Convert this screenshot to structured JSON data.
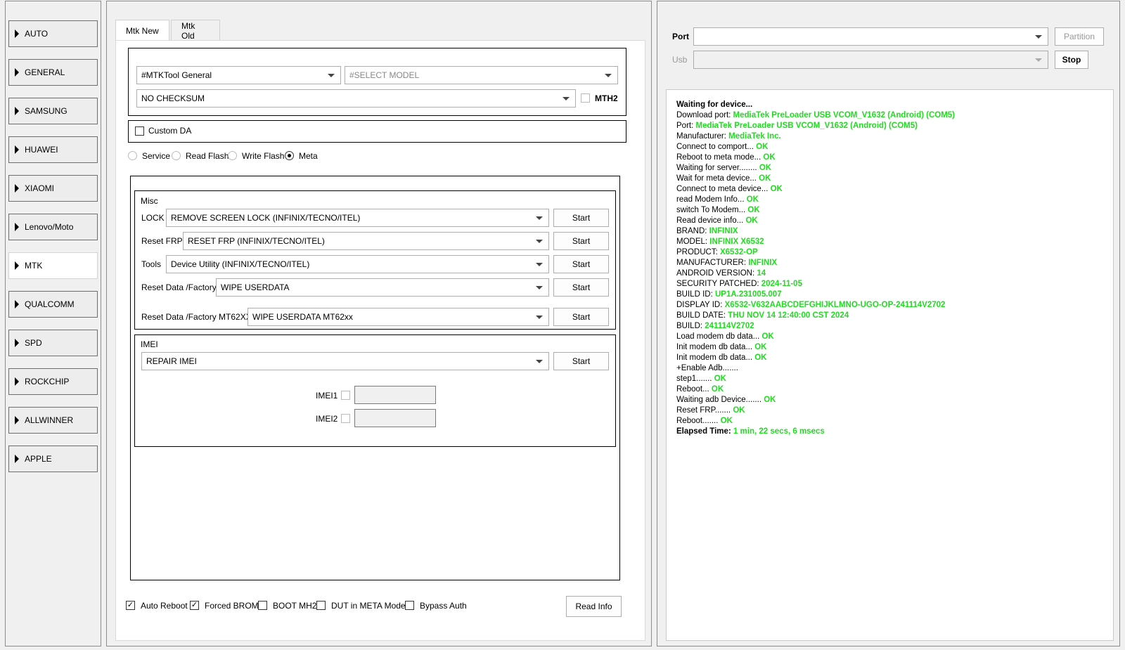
{
  "sidebar": {
    "items": [
      {
        "label": "AUTO"
      },
      {
        "label": "GENERAL"
      },
      {
        "label": "SAMSUNG"
      },
      {
        "label": "HUAWEI"
      },
      {
        "label": "XIAOMI"
      },
      {
        "label": "Lenovo/Moto"
      },
      {
        "label": "MTK"
      },
      {
        "label": "QUALCOMM"
      },
      {
        "label": "SPD"
      },
      {
        "label": "ROCKCHIP"
      },
      {
        "label": "ALLWINNER"
      },
      {
        "label": "APPLE"
      }
    ],
    "active": "MTK"
  },
  "tabs": [
    {
      "label": "Mtk New"
    },
    {
      "label": "Mtk Old"
    }
  ],
  "config": {
    "tool_select": "#MTKTool General",
    "model_select": "#SELECT MODEL",
    "checksum_select": "NO CHECKSUM",
    "mth2_label": "MTH2",
    "custom_da_label": "Custom DA"
  },
  "modes": [
    {
      "label": "Service",
      "selected": false
    },
    {
      "label": "Read Flash",
      "selected": false
    },
    {
      "label": "Write Flash",
      "selected": false
    },
    {
      "label": "Meta",
      "selected": true
    }
  ],
  "misc": {
    "title": "Misc",
    "rows": [
      {
        "label": "LOCK",
        "value": "REMOVE SCREEN LOCK (INFINIX/TECNO/ITEL)",
        "button": "Start"
      },
      {
        "label": "Reset FRP",
        "value": "RESET FRP (INFINIX/TECNO/ITEL)",
        "button": "Start"
      },
      {
        "label": "Tools",
        "value": "Device Utility (INFINIX/TECNO/ITEL)",
        "button": "Start"
      },
      {
        "label": "Reset Data /Factory",
        "value": "WIPE USERDATA",
        "button": "Start"
      },
      {
        "label": "Reset Data /Factory MT62XX",
        "value": "WIPE USERDATA MT62xx",
        "button": "Start"
      }
    ]
  },
  "imei": {
    "title": "IMEI",
    "select": "REPAIR IMEI",
    "button": "Start",
    "imei1_label": "IMEI1",
    "imei2_label": "IMEI2"
  },
  "options": [
    {
      "label": "Auto Reboot",
      "checked": true
    },
    {
      "label": "Forced BROM",
      "checked": true
    },
    {
      "label": "BOOT MH2",
      "checked": false
    },
    {
      "label": "DUT in META Mode",
      "checked": false
    },
    {
      "label": "Bypass Auth",
      "checked": false
    }
  ],
  "read_info_button": "Read Info",
  "right": {
    "port_label": "Port",
    "usb_label": "Usb",
    "partition_button": "Partition",
    "stop_button": "Stop"
  },
  "log": [
    {
      "text": "Waiting for device...",
      "status": "",
      "bold": true
    },
    {
      "text": "Download port: ",
      "status": "MediaTek PreLoader USB VCOM_V1632 (Android) (COM5)"
    },
    {
      "text": "Port: ",
      "status": "MediaTek PreLoader USB VCOM_V1632 (Android) (COM5)"
    },
    {
      "text": "Manufacturer: ",
      "status": "MediaTek Inc."
    },
    {
      "text": "Connect to comport... ",
      "status": "OK"
    },
    {
      "text": "Reboot to meta mode... ",
      "status": "OK"
    },
    {
      "text": "Waiting for server........ ",
      "status": "OK"
    },
    {
      "text": "Wait for meta device... ",
      "status": "OK"
    },
    {
      "text": "Connect to meta device... ",
      "status": "OK"
    },
    {
      "text": "read Modem Info... ",
      "status": "OK"
    },
    {
      "text": "switch To Modem... ",
      "status": "OK"
    },
    {
      "text": "Read device info... ",
      "status": "OK"
    },
    {
      "text": " BRAND: ",
      "status": "INFINIX"
    },
    {
      "text": " MODEL: ",
      "status": "INFINIX X6532"
    },
    {
      "text": " PRODUCT: ",
      "status": "X6532-OP"
    },
    {
      "text": " MANUFACTURER: ",
      "status": "INFINIX"
    },
    {
      "text": " ANDROID VERSION: ",
      "status": "14"
    },
    {
      "text": " SECURITY PATCHED: ",
      "status": "2024-11-05"
    },
    {
      "text": " BUILD ID: ",
      "status": "UP1A.231005.007"
    },
    {
      "text": " DISPLAY ID: ",
      "status": "X6532-V632AABCDEFGHIJKLMNO-UGO-OP-241114V2702"
    },
    {
      "text": " BUILD DATE: ",
      "status": "THU NOV 14 12:40:00 CST 2024"
    },
    {
      "text": " BUILD: ",
      "status": "241114V2702"
    },
    {
      "text": "Load modem db data... ",
      "status": "OK"
    },
    {
      "text": "Init modem db data... ",
      "status": "OK"
    },
    {
      "text": "Init modem db data... ",
      "status": "OK"
    },
    {
      "text": "+Enable Adb.......",
      "status": ""
    },
    {
      "text": "step1....... ",
      "status": "OK"
    },
    {
      "text": "Reboot... ",
      "status": "OK"
    },
    {
      "text": "Waiting adb Device....... ",
      "status": "OK"
    },
    {
      "text": "Reset FRP....... ",
      "status": "OK"
    },
    {
      "text": "Reboot....... ",
      "status": "OK"
    },
    {
      "text": "Elapsed Time: ",
      "status": "1 min, 22 secs, 6 msecs",
      "bold": true
    }
  ],
  "colors": {
    "ok_green": "#1fdc1f",
    "panel_bg": "#f0f0f0"
  }
}
